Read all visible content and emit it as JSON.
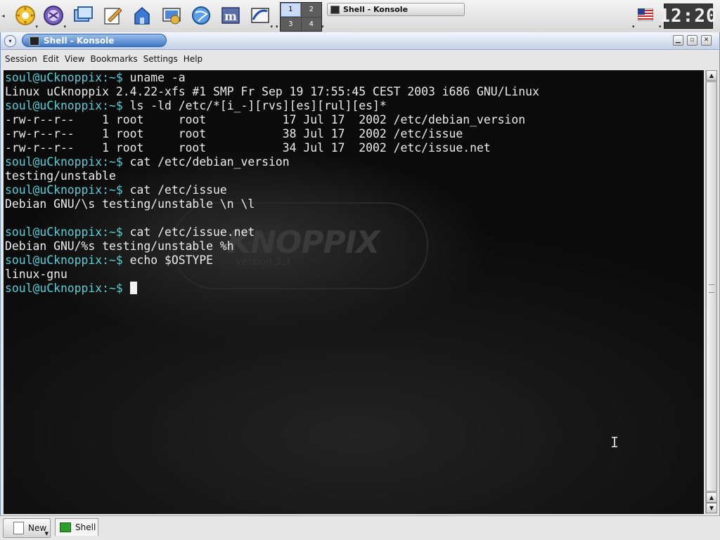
{
  "panel": {
    "launchers": [
      {
        "name": "kde-menu-icon"
      },
      {
        "name": "knoppix-icon"
      },
      {
        "name": "window-list-icon"
      },
      {
        "name": "text-editor-icon"
      },
      {
        "name": "home-folder-icon"
      },
      {
        "name": "control-center-icon"
      },
      {
        "name": "web-browser-icon"
      },
      {
        "name": "terminal-launcher-icon"
      },
      {
        "name": "office-icon"
      }
    ],
    "pager": [
      "1",
      "2",
      "3",
      "4"
    ],
    "active_desktop": "1",
    "taskbar_item": "Shell - Konsole",
    "clock": "12:20",
    "keyboard_layout": "us"
  },
  "window": {
    "title": "Shell - Konsole",
    "menu": [
      "Session",
      "Edit",
      "View",
      "Bookmarks",
      "Settings",
      "Help"
    ]
  },
  "terminal": {
    "prompt": "soul@uCknoppix:~$",
    "lines": [
      {
        "prompt": "soul@uCknoppix:~$",
        "text": " uname -a"
      },
      {
        "prompt": "",
        "text": "Linux uCknoppix 2.4.22-xfs #1 SMP Fr Sep 19 17:55:45 CEST 2003 i686 GNU/Linux"
      },
      {
        "prompt": "soul@uCknoppix:~$",
        "text": " ls -ld /etc/*[i_-][rvs][es][rul][es]*"
      },
      {
        "prompt": "",
        "text": "-rw-r--r--    1 root     root           17 Jul 17  2002 /etc/debian_version"
      },
      {
        "prompt": "",
        "text": "-rw-r--r--    1 root     root           38 Jul 17  2002 /etc/issue"
      },
      {
        "prompt": "",
        "text": "-rw-r--r--    1 root     root           34 Jul 17  2002 /etc/issue.net"
      },
      {
        "prompt": "soul@uCknoppix:~$",
        "text": " cat /etc/debian_version"
      },
      {
        "prompt": "",
        "text": "testing/unstable"
      },
      {
        "prompt": "soul@uCknoppix:~$",
        "text": " cat /etc/issue"
      },
      {
        "prompt": "",
        "text": "Debian GNU/\\s testing/unstable \\n \\l"
      },
      {
        "prompt": "",
        "text": ""
      },
      {
        "prompt": "soul@uCknoppix:~$",
        "text": " cat /etc/issue.net"
      },
      {
        "prompt": "",
        "text": "Debian GNU/%s testing/unstable %h"
      },
      {
        "prompt": "soul@uCknoppix:~$",
        "text": " echo $OSTYPE"
      },
      {
        "prompt": "",
        "text": "linux-gnu"
      },
      {
        "prompt": "soul@uCknoppix:~$",
        "text": " "
      }
    ],
    "watermark": "KNOPPIX",
    "watermark_sub": "Version 3.3"
  },
  "tabs": {
    "new_label": "New",
    "items": [
      {
        "label": "Shell"
      }
    ]
  }
}
